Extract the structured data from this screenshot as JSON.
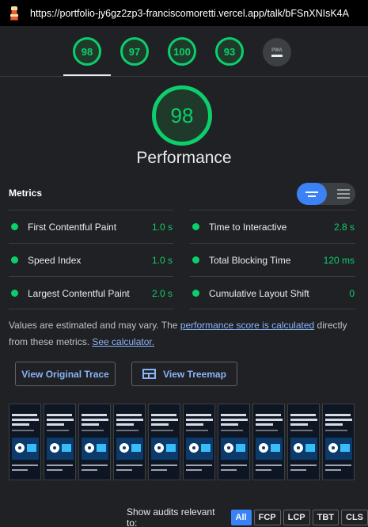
{
  "header": {
    "url": "https://portfolio-jy6gz2zp3-franciscomoretti.vercel.app/talk/bFSnXNIsK4A"
  },
  "gauges": [
    {
      "score": "98",
      "name": "Performance",
      "selected": true
    },
    {
      "score": "97"
    },
    {
      "score": "100"
    },
    {
      "score": "93"
    },
    {
      "label": "PWA"
    }
  ],
  "performance": {
    "score": "98",
    "title": "Performance"
  },
  "metrics": {
    "heading": "Metrics",
    "items": [
      {
        "label": "First Contentful Paint",
        "value": "1.0 s"
      },
      {
        "label": "Time to Interactive",
        "value": "2.8 s"
      },
      {
        "label": "Speed Index",
        "value": "1.0 s"
      },
      {
        "label": "Total Blocking Time",
        "value": "120 ms"
      },
      {
        "label": "Largest Contentful Paint",
        "value": "2.0 s"
      },
      {
        "label": "Cumulative Layout Shift",
        "value": "0"
      }
    ]
  },
  "note": {
    "prefix": "Values are estimated and may vary. The ",
    "link1": "performance score is calculated",
    "middle": " directly from these metrics. ",
    "link2": "See calculator."
  },
  "buttons": {
    "original_trace": "View Original Trace",
    "treemap": "View Treemap"
  },
  "filmstrip": {
    "frame_count": 10
  },
  "audits_filter": {
    "label": "Show audits relevant to:",
    "chips": [
      "All",
      "FCP",
      "LCP",
      "TBT",
      "CLS"
    ],
    "active": "All"
  },
  "colors": {
    "pass": "#0cce6b",
    "link": "#8ab4f8",
    "accent": "#3b82f6",
    "background": "#202124"
  }
}
